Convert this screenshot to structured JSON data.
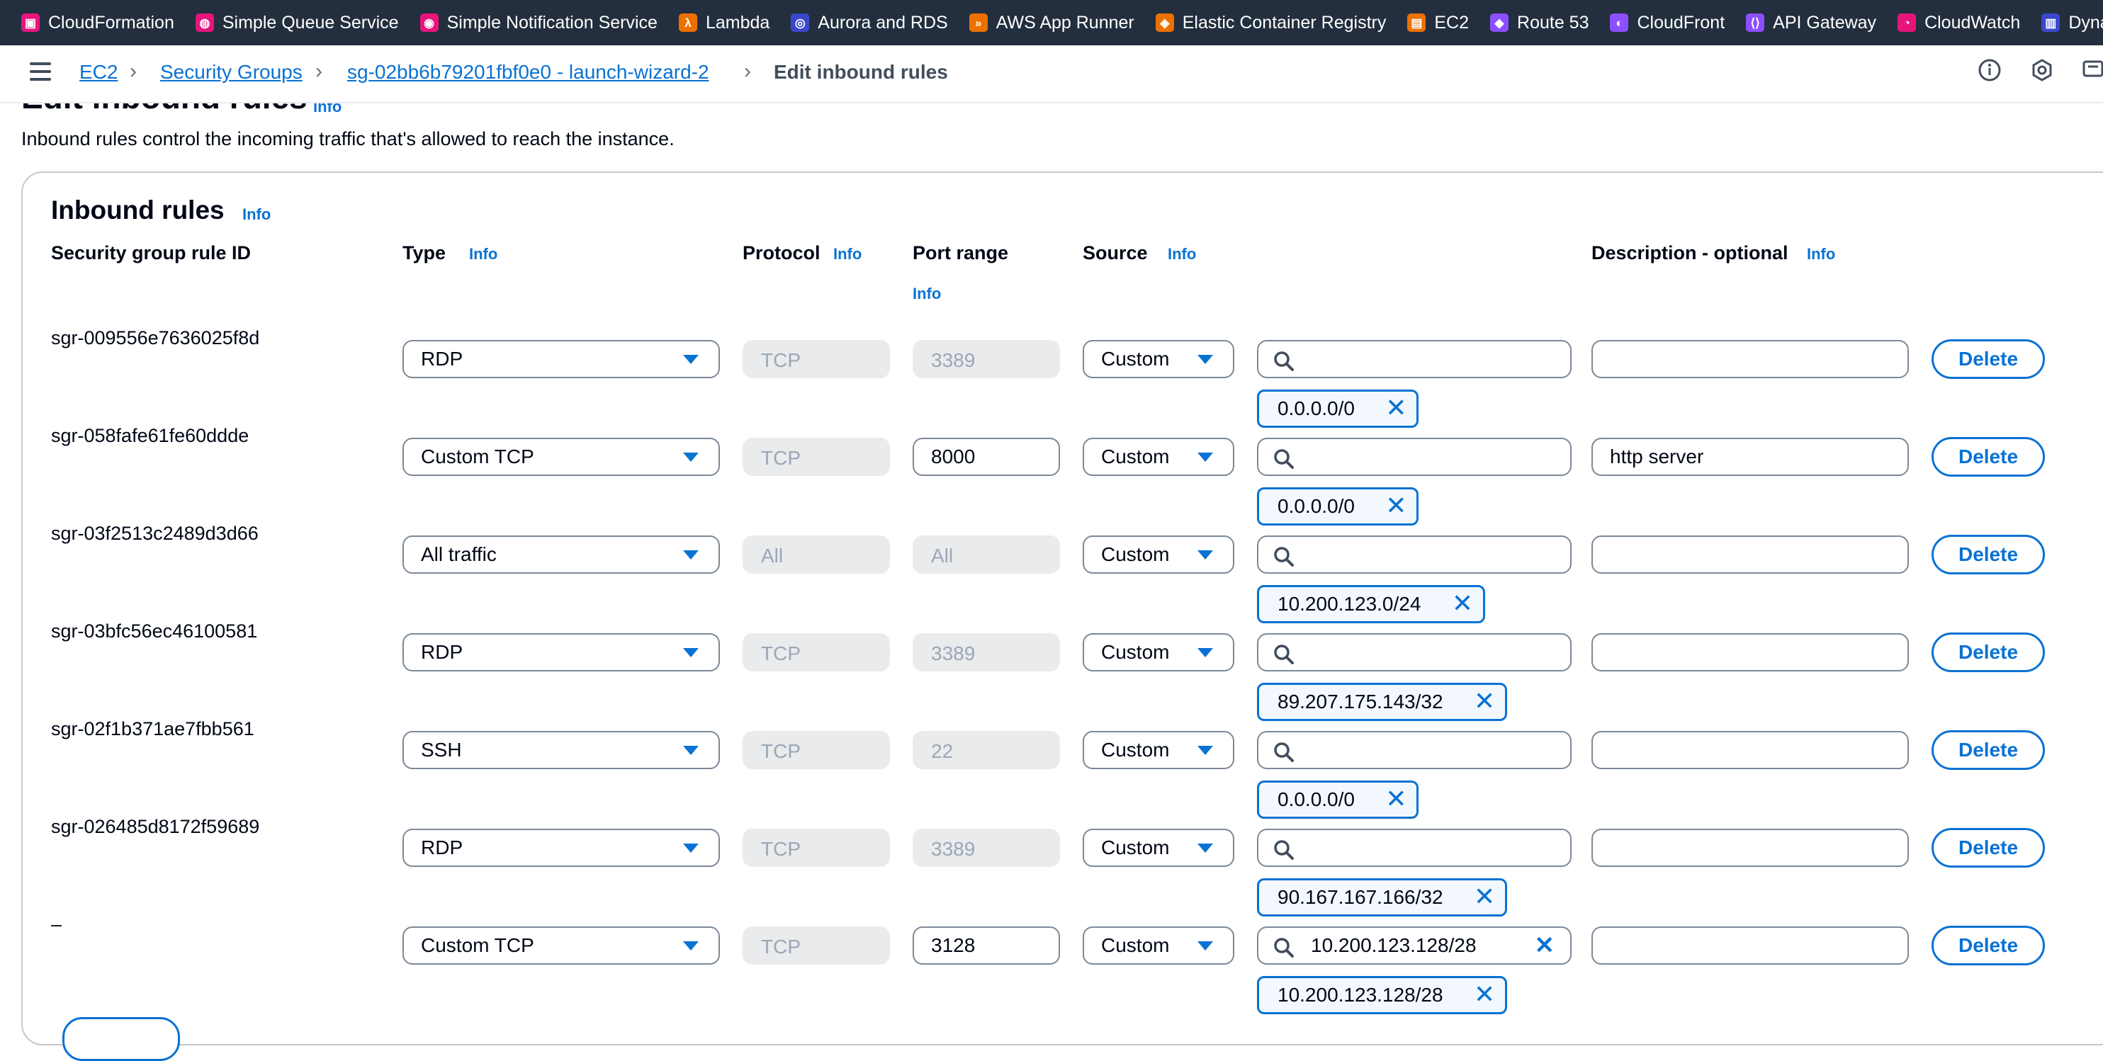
{
  "favorites": [
    {
      "label": "CloudFormation",
      "icon": "cloudformation-icon",
      "color": "pink"
    },
    {
      "label": "Simple Queue Service",
      "icon": "sqs-icon",
      "color": "pink"
    },
    {
      "label": "Simple Notification Service",
      "icon": "sns-icon",
      "color": "pink"
    },
    {
      "label": "Lambda",
      "icon": "lambda-icon",
      "color": "orange"
    },
    {
      "label": "Aurora and RDS",
      "icon": "rds-icon",
      "color": "rds"
    },
    {
      "label": "AWS App Runner",
      "icon": "app-runner-icon",
      "color": "orange"
    },
    {
      "label": "Elastic Container Registry",
      "icon": "ecr-icon",
      "color": "orange"
    },
    {
      "label": "EC2",
      "icon": "ec2-icon",
      "color": "orange"
    },
    {
      "label": "Route 53",
      "icon": "route53-icon",
      "color": "purple"
    },
    {
      "label": "CloudFront",
      "icon": "cloudfront-icon",
      "color": "purple"
    },
    {
      "label": "API Gateway",
      "icon": "api-gateway-icon",
      "color": "purple"
    },
    {
      "label": "CloudWatch",
      "icon": "cloudwatch-icon",
      "color": "pink"
    },
    {
      "label": "Dynam",
      "icon": "dynamodb-icon",
      "color": "rds"
    }
  ],
  "breadcrumb": {
    "ec2": "EC2",
    "security_groups": "Security Groups",
    "sg": "sg-02bb6b79201fbf0e0 - launch-wizard-2",
    "current": "Edit inbound rules"
  },
  "page": {
    "title": "Edit inbound rules",
    "info": "Info",
    "description": "Inbound rules control the incoming traffic that's allowed to reach the instance."
  },
  "panel": {
    "title": "Inbound rules",
    "info": "Info",
    "columns": {
      "rule_id": "Security group rule ID",
      "type": "Type",
      "protocol": "Protocol",
      "port_range": "Port range",
      "source": "Source",
      "description": "Description - optional",
      "info": "Info"
    }
  },
  "rules": [
    {
      "id": "sgr-009556e7636025f8d",
      "type": "RDP",
      "protocol": "TCP",
      "port": "3389",
      "port_editable": false,
      "source": "Custom",
      "search_value": "",
      "token": "0.0.0.0/0",
      "description": "",
      "delete": "Delete"
    },
    {
      "id": "sgr-058fafe61fe60ddde",
      "type": "Custom TCP",
      "protocol": "TCP",
      "port": "8000",
      "port_editable": true,
      "source": "Custom",
      "search_value": "",
      "token": "0.0.0.0/0",
      "description": "http server",
      "delete": "Delete"
    },
    {
      "id": "sgr-03f2513c2489d3d66",
      "type": "All traffic",
      "protocol": "All",
      "port": "All",
      "port_editable": false,
      "source": "Custom",
      "search_value": "",
      "token": "10.200.123.0/24",
      "description": "",
      "delete": "Delete"
    },
    {
      "id": "sgr-03bfc56ec46100581",
      "type": "RDP",
      "protocol": "TCP",
      "port": "3389",
      "port_editable": false,
      "source": "Custom",
      "search_value": "",
      "token": "89.207.175.143/32",
      "description": "",
      "delete": "Delete"
    },
    {
      "id": "sgr-02f1b371ae7fbb561",
      "type": "SSH",
      "protocol": "TCP",
      "port": "22",
      "port_editable": false,
      "source": "Custom",
      "search_value": "",
      "token": "0.0.0.0/0",
      "description": "",
      "delete": "Delete"
    },
    {
      "id": "sgr-026485d8172f59689",
      "type": "RDP",
      "protocol": "TCP",
      "port": "3389",
      "port_editable": false,
      "source": "Custom",
      "search_value": "",
      "token": "90.167.167.166/32",
      "description": "",
      "delete": "Delete"
    },
    {
      "id": "–",
      "type": "Custom TCP",
      "protocol": "TCP",
      "port": "3128",
      "port_editable": true,
      "source": "Custom",
      "search_value": "10.200.123.128/28",
      "token": "10.200.123.128/28",
      "description": "",
      "delete": "Delete"
    }
  ]
}
